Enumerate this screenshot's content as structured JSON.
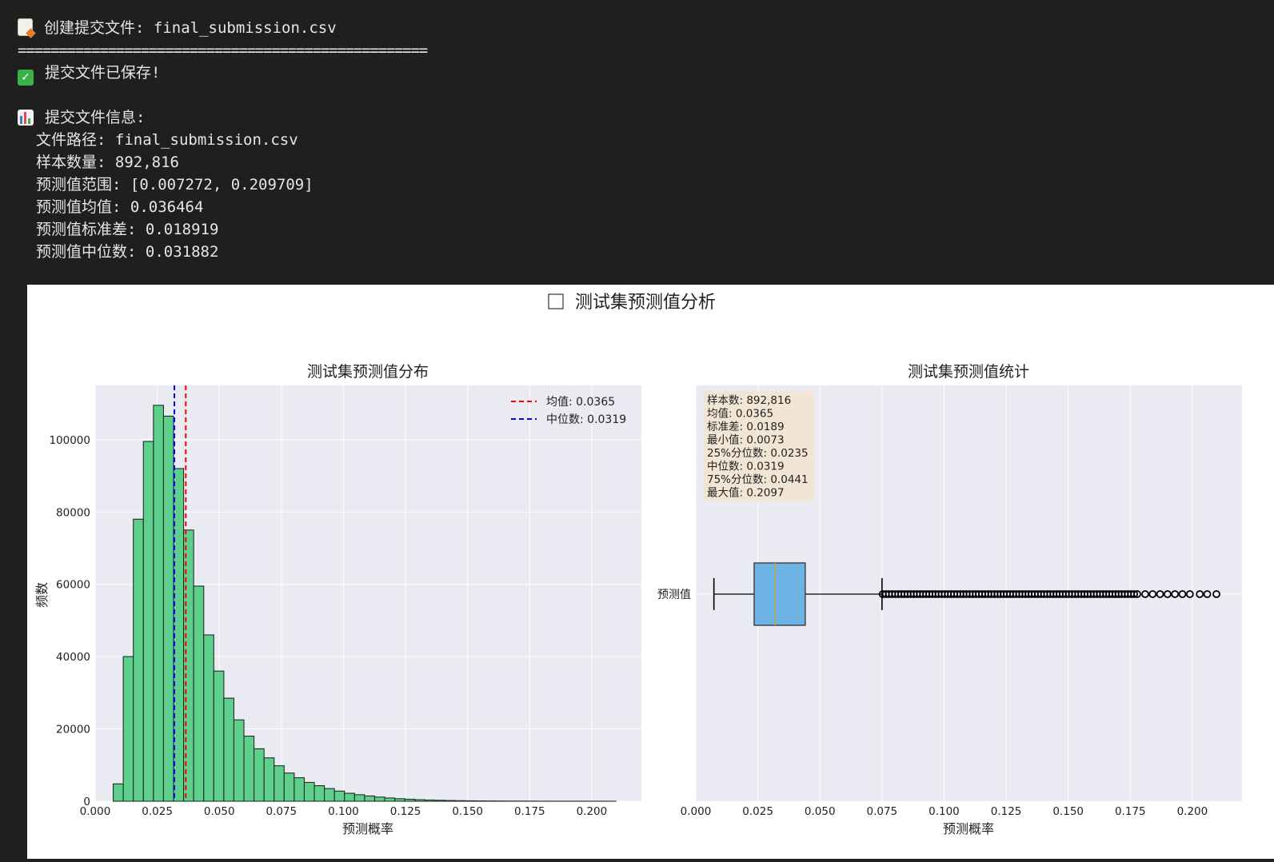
{
  "console": {
    "create_line": "创建提交文件: final_submission.csv",
    "separator": "==================================================",
    "saved_line": "提交文件已保存!",
    "info_header": "提交文件信息:",
    "info_lines": [
      "文件路径: final_submission.csv",
      "样本数量: 892,816",
      "预测值范围: [0.007272, 0.209709]",
      "预测值均值: 0.036464",
      "预测值标准差: 0.018919",
      "预测值中位数: 0.031882"
    ],
    "icons": [
      "memo-icon",
      "check-mark-icon",
      "bar-chart-icon"
    ]
  },
  "figure": {
    "suptitle": "测试集预测值分析",
    "suptitle_glyph": "☐",
    "colors": {
      "bar_fill": "#5fd08b",
      "bar_edge": "#1f2d24",
      "mean_line": "#ff0000",
      "median_line": "#0000ff",
      "box_fill": "#6db3e3",
      "axes_bg": "#eaeaf2",
      "stats_box": "#f2e5d2"
    }
  },
  "chart_data": [
    {
      "type": "bar",
      "subtype": "histogram",
      "title": "测试集预测值分布",
      "xlabel": "预测概率",
      "ylabel": "频数",
      "xlim": [
        0.0,
        0.22
      ],
      "ylim": [
        0,
        115000
      ],
      "xticks": [
        "0.000",
        "0.025",
        "0.050",
        "0.075",
        "0.100",
        "0.125",
        "0.150",
        "0.175",
        "0.200"
      ],
      "yticks": [
        "0",
        "20000",
        "40000",
        "60000",
        "80000",
        "100000"
      ],
      "bin_start": 0.00727,
      "bin_width": 0.00405,
      "values": [
        4800,
        40000,
        78000,
        99500,
        109500,
        106500,
        92000,
        75000,
        59500,
        46000,
        36000,
        28500,
        22500,
        18000,
        14500,
        12000,
        9800,
        7800,
        6500,
        5200,
        4300,
        3500,
        2800,
        2200,
        1800,
        1450,
        1150,
        900,
        700,
        550,
        420,
        330,
        260,
        200,
        150,
        120,
        90,
        70,
        55,
        40,
        30,
        25,
        20,
        15,
        12,
        10,
        8,
        6,
        5,
        4
      ],
      "vlines": [
        {
          "name": "均值: 0.0365",
          "x": 0.0365,
          "color": "#ff0000"
        },
        {
          "name": "中位数: 0.0319",
          "x": 0.0319,
          "color": "#0000ff"
        }
      ],
      "legend": "top-right",
      "grid": true
    },
    {
      "type": "boxplot",
      "title": "测试集预测值统计",
      "xlabel": "预测概率",
      "category": "预测值",
      "xlim": [
        0.0,
        0.22
      ],
      "xticks": [
        "0.000",
        "0.025",
        "0.050",
        "0.075",
        "0.100",
        "0.125",
        "0.150",
        "0.175",
        "0.200"
      ],
      "min_whisker": 0.0073,
      "q1": 0.0235,
      "median": 0.0319,
      "q3": 0.0441,
      "max_whisker": 0.075,
      "outlier_max": 0.2097,
      "stats_box": {
        "lines": [
          "样本数: 892,816",
          "均值: 0.0365",
          "标准差: 0.0189",
          "最小值: 0.0073",
          "25%分位数: 0.0235",
          "中位数: 0.0319",
          "75%分位数: 0.0441",
          "最大值: 0.2097"
        ],
        "placement": "top-left"
      },
      "grid": true
    }
  ]
}
